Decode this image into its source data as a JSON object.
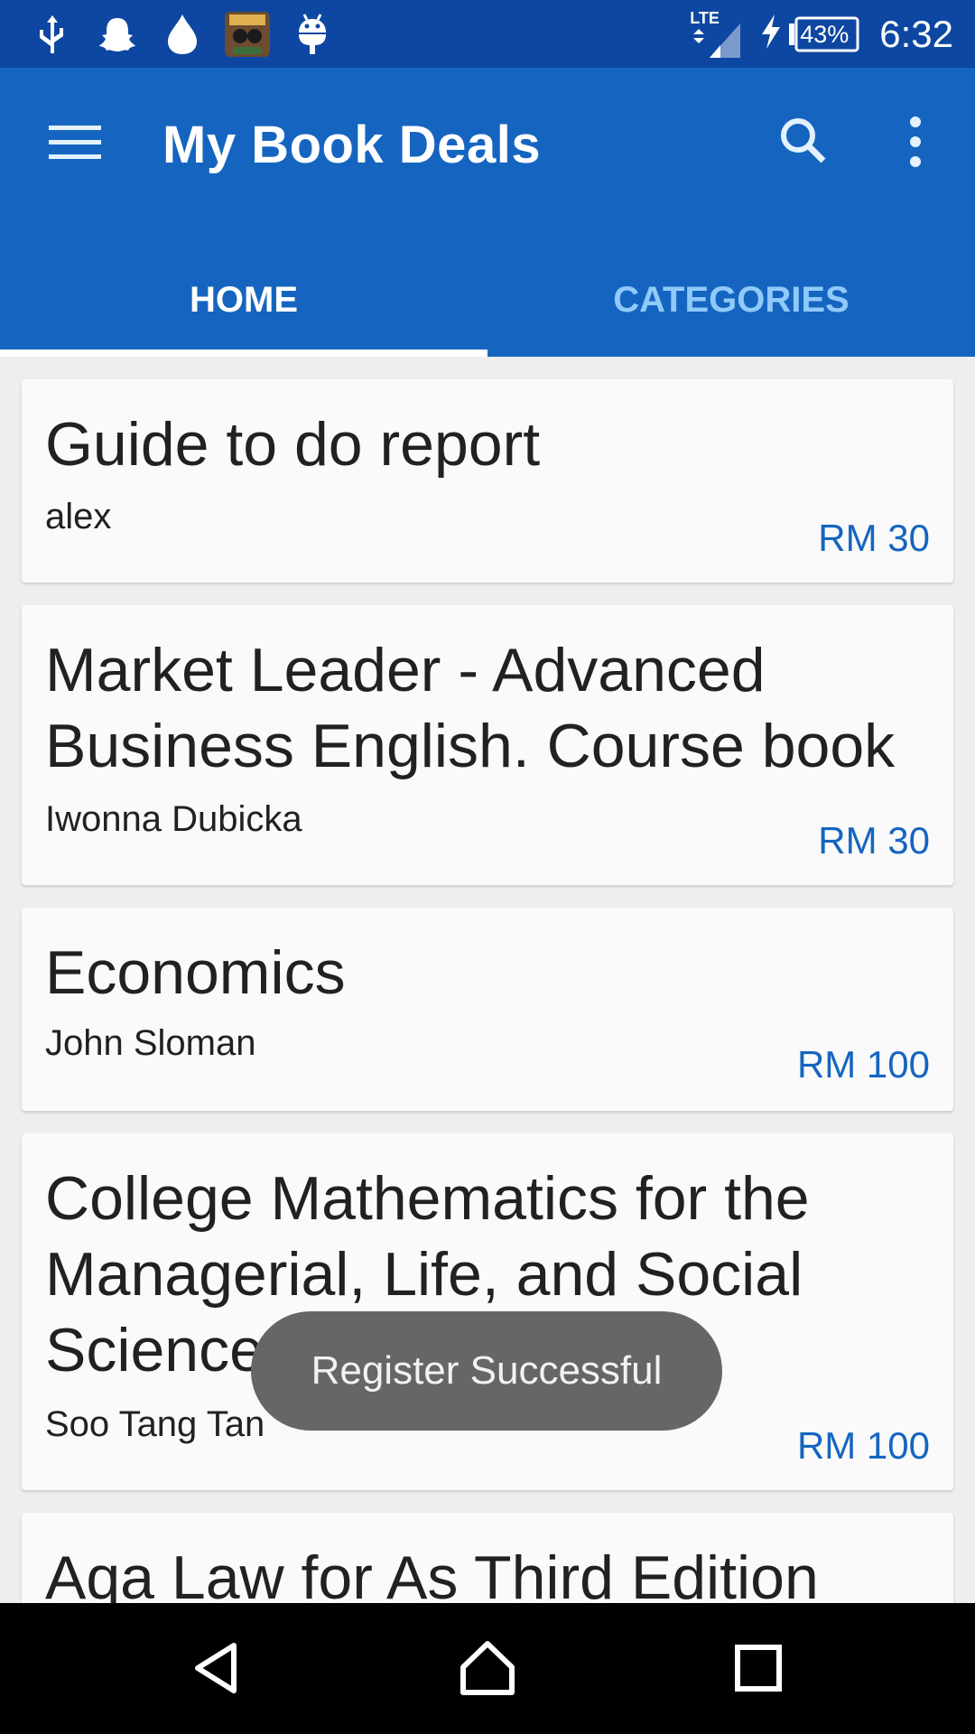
{
  "status_bar": {
    "battery": "43%",
    "time": "6:32",
    "network": "LTE",
    "icons": [
      "usb-icon",
      "snapchat-icon",
      "drop-icon",
      "game-app-icon",
      "android-debug-icon",
      "lte-signal-icon",
      "charging-icon",
      "battery-icon"
    ]
  },
  "app_bar": {
    "title": "My Book Deals",
    "menu_icon": "hamburger-menu-icon",
    "search_icon": "search-icon",
    "more_icon": "overflow-menu-icon"
  },
  "tabs": [
    {
      "label": "HOME",
      "active": true
    },
    {
      "label": "CATEGORIES",
      "active": false
    }
  ],
  "books": [
    {
      "title": "Guide to do report",
      "author": "alex",
      "price": "RM 30"
    },
    {
      "title": "Market Leader - Advanced Business English. Course book",
      "author": "Iwonna Dubicka",
      "price": "RM 30"
    },
    {
      "title": "Economics",
      "author": "John Sloman",
      "price": "RM 100"
    },
    {
      "title": "College Mathematics for the Managerial, Life, and Social Sciences",
      "author": "Soo Tang Tan",
      "price": "RM 100"
    },
    {
      "title": "Aqa Law for As Third Edition"
    }
  ],
  "toast": {
    "message": "Register Successful"
  },
  "nav_bar": {
    "icons": [
      "back-icon",
      "home-icon",
      "recents-icon"
    ]
  },
  "colors": {
    "status_bar": "#0d47a1",
    "app_bar": "#1565c0",
    "price": "#1565c0",
    "inactive_tab": "#90caf9"
  }
}
